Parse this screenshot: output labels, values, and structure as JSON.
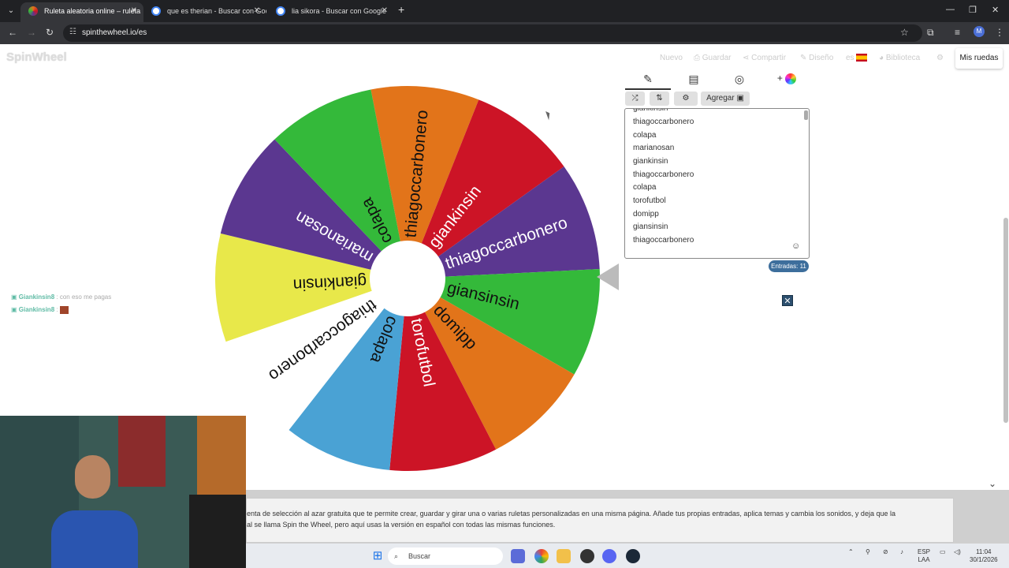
{
  "browser": {
    "tabs": [
      {
        "title": "Ruleta aleatoria online – ruleta",
        "active": true
      },
      {
        "title": "que es therian - Buscar con Goo",
        "active": false
      },
      {
        "title": "lia sikora - Buscar con Google",
        "active": false
      }
    ],
    "url": "spinthewheel.io/es"
  },
  "site": {
    "logo": "SpinWheel",
    "nav": [
      "Nuevo",
      "Guardar",
      "Compartir",
      "Diseño",
      "es",
      "Biblioteca"
    ],
    "my_wheels": "Mis ruedas"
  },
  "chat": [
    {
      "user": "Giankinsin8",
      "message": ": con eso me pagas"
    },
    {
      "user": "Giankinsin8",
      "message": ":"
    }
  ],
  "wheel": {
    "segments": [
      {
        "label": "thiagoccarbonero",
        "color": "#e2741a"
      },
      {
        "label": "giankinsin",
        "color": "#cc1426"
      },
      {
        "label": "thiagoccarbonero",
        "color": "#5b3790"
      },
      {
        "label": "giansinsin",
        "color": "#34b93a"
      },
      {
        "label": "domipp",
        "color": "#e2741a"
      },
      {
        "label": "torofutbol",
        "color": "#cc1426"
      },
      {
        "label": "colapa",
        "color": "#4aa2d4"
      },
      {
        "label": "thiagoccarbonero",
        "color": "#ffffff"
      },
      {
        "label": "giankinsin",
        "color": "#e8e84a"
      },
      {
        "label": "marianosan",
        "color": "#5b3790"
      },
      {
        "label": "colapa",
        "color": "#34b93a"
      }
    ]
  },
  "panel": {
    "tools": {
      "add_label": "Agregar"
    },
    "entries_partial": "giankinsin",
    "entries": [
      "thiagoccarbonero",
      "colapa",
      "marianosan",
      "giankinsin",
      "thiagoccarbonero",
      "colapa",
      "torofutbol",
      "domipp",
      "giansinsin",
      "thiagoccarbonero"
    ],
    "entries_badge": "Entradas: 11"
  },
  "description": {
    "line1": "enta de selección al azar gratuita que te permite crear, guardar y girar una o varias ruletas personalizadas en una misma página. Añade tus propias entradas, aplica temas y cambia los sonidos, y deja que la",
    "line2": "al se llama Spin the Wheel, pero aquí usas la versión en español con todas las mismas funciones."
  },
  "taskbar": {
    "search": "Buscar",
    "lang": "ESP",
    "lang2": "LAA",
    "time": "11:04",
    "date": "30/1/2026"
  }
}
